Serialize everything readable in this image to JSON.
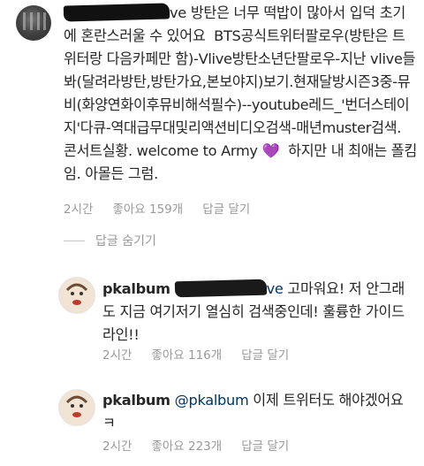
{
  "top_comment": {
    "text": "방탄은 너무 떡밥이 많아서 입덕 초기에 혼란스러울 수 있어요  BTS공식트위터팔로우(방탄은 트위터랑 다음카페만 함)-Vlive방탄소년단팔로우-지난 vlive들봐(달려라방탄,방탄가요,본보야지)보기.현재달방시즌3중-뮤비(화양연화이후뮤비해석필수)--youtube레드_'번더스테이지'다큐-역대급무대및리액션비디오검색-매년muster검색. 콘서트실황. welcome to Army ",
    "heart": "💜",
    "text_after": "  하지만 내 최애는 폴킴임. 아몰든 그럼.",
    "username_visible_suffix": "ve",
    "time": "2시간",
    "likes": "좋아요 159개",
    "reply_label": "답글 달기"
  },
  "hide_replies_label": "답글 숨기기",
  "replies": [
    {
      "username": "pkalbum",
      "mention_visible_suffix": "ve",
      "text": " 고마워요! 저 안그래도 지금 여기저기 열심히 검색중인데! 훌륭한 가이드라인!!",
      "time": "2시간",
      "likes": "좋아요 116개",
      "reply_label": "답글 달기"
    },
    {
      "username": "pkalbum",
      "mention": "@pkalbum",
      "text": " 이제 트위터도 해야겠어요 ㅋ",
      "time": "2시간",
      "likes": "좋아요 223개",
      "reply_label": "답글 달기"
    }
  ],
  "colors": {
    "text": "#262626",
    "meta": "#999999",
    "mention": "#003569"
  }
}
